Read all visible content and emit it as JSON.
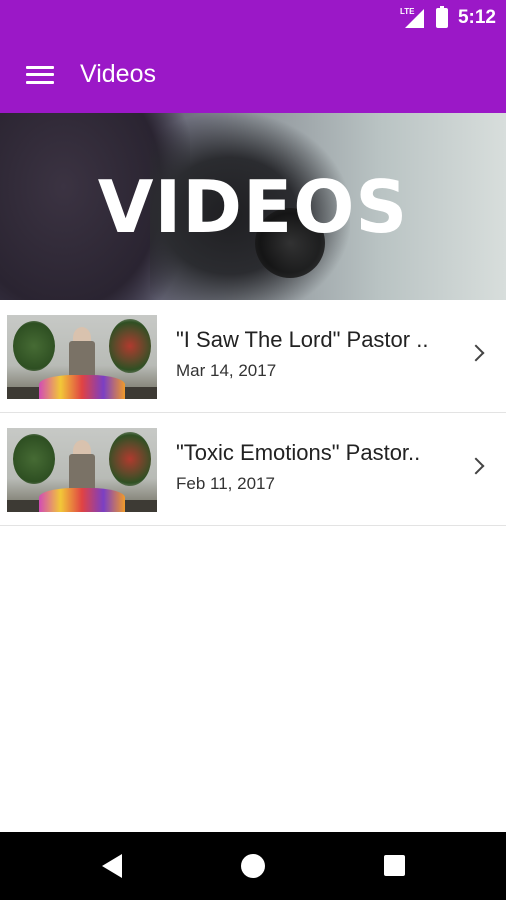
{
  "status_bar": {
    "network": "LTE",
    "time": "5:12"
  },
  "app_bar": {
    "title": "Videos",
    "menu_icon": "hamburger-menu-icon"
  },
  "hero": {
    "title": "VIDEOS"
  },
  "videos": [
    {
      "title": "\"I Saw The Lord\" Pastor ..",
      "date": "Mar 14, 2017"
    },
    {
      "title": "\"Toxic Emotions\" Pastor..",
      "date": "Feb 11, 2017"
    }
  ],
  "colors": {
    "primary": "#9b18c7",
    "nav_bar": "#000000"
  },
  "nav": {
    "back_icon": "back-triangle-icon",
    "home_icon": "home-circle-icon",
    "recents_icon": "recents-square-icon"
  }
}
